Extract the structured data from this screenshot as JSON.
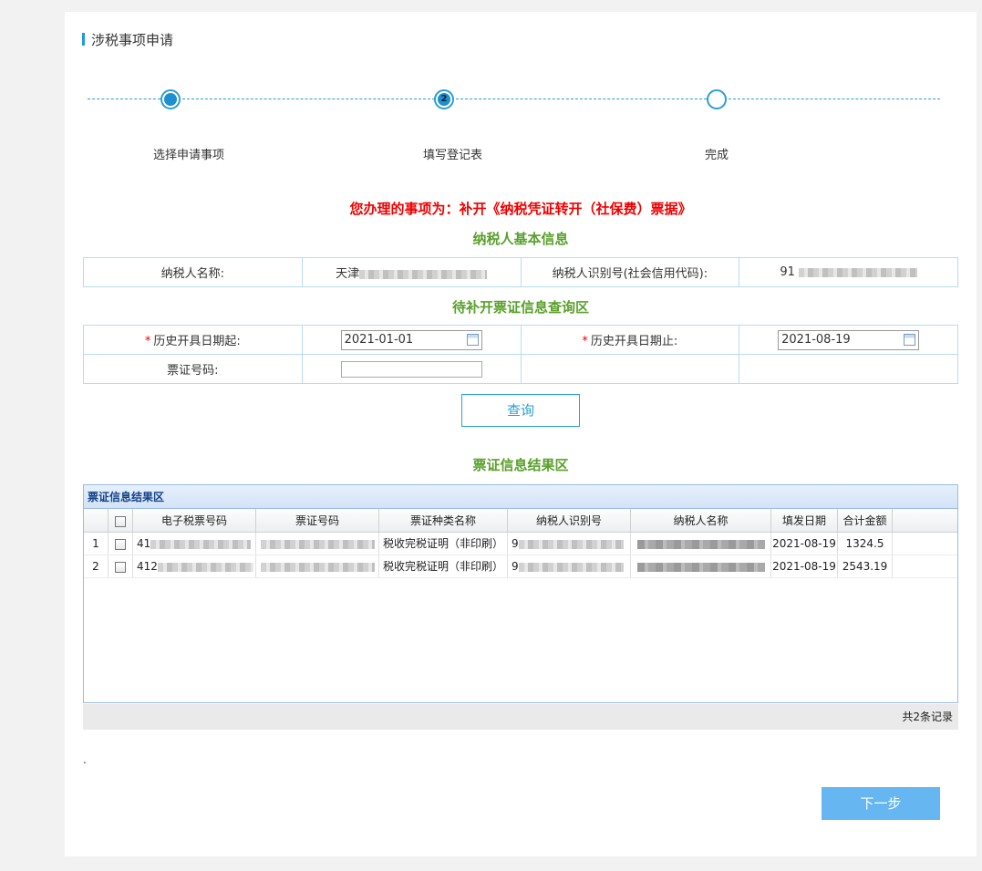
{
  "page_title": "涉税事项申请",
  "steps": [
    "选择申请事项",
    "填写登记表",
    "完成"
  ],
  "step2_number": "2",
  "matter_title": "您办理的事项为：补开《纳税凭证转开（社保费）票据》",
  "basic_info_title": "纳税人基本信息",
  "basic_info": {
    "name_label": "纳税人名称:",
    "name_value": "天津",
    "id_label": "纳税人识别号(社会信用代码):",
    "id_value": "91"
  },
  "query_section_title": "待补开票证信息查询区",
  "query": {
    "start_label": "历史开具日期起:",
    "start_value": "2021-01-01",
    "end_label": "历史开具日期止:",
    "end_value": "2021-08-19",
    "ticket_label": "票证号码:",
    "required_mark": "*",
    "button": "查询"
  },
  "result_section_title": "票证信息结果区",
  "grid": {
    "title": "票证信息结果区",
    "columns": [
      "电子税票号码",
      "票证号码",
      "票证种类名称",
      "纳税人识别号",
      "纳税人名称",
      "填发日期",
      "合计金额"
    ],
    "rows": [
      {
        "num": "1",
        "tax_no": "41",
        "ticket_no": "",
        "type": "税收完税证明（非印刷）",
        "taxpayer_id": "9",
        "date": "2021-08-19",
        "amount": "1324.5"
      },
      {
        "num": "2",
        "tax_no": "412",
        "ticket_no": "",
        "type": "税收完税证明（非印刷）",
        "taxpayer_id": "9",
        "date": "2021-08-19",
        "amount": "2543.19"
      }
    ],
    "total": "共2条记录"
  },
  "dot": ".",
  "next_button": "下一步",
  "colors": {
    "accent": "#2b9fd4",
    "red": "#e00000",
    "green": "#5aa02c",
    "next_btn": "#66b7f1"
  }
}
